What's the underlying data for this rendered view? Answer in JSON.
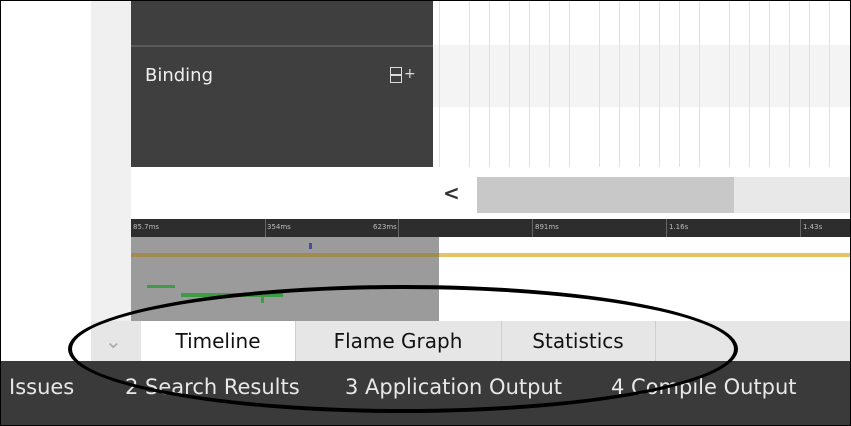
{
  "category": {
    "label": "Binding",
    "expand_icon": "expand-rows-icon"
  },
  "scrollbar": {
    "left_arrow": "<",
    "thumb_fraction": 0.69
  },
  "ruler": {
    "ticks": [
      "85.7ms",
      "354ms",
      "623ms",
      "891ms",
      "1.16s",
      "1.43s"
    ]
  },
  "tabs": [
    {
      "label": "Timeline",
      "active": true
    },
    {
      "label": "Flame Graph",
      "active": false
    },
    {
      "label": "Statistics",
      "active": false
    }
  ],
  "collapse_icon": "chevron-down-icon",
  "output_panes": [
    {
      "label": "Issues"
    },
    {
      "label": "2  Search Results"
    },
    {
      "label": "3  Application Output"
    },
    {
      "label": "4  Compile Output"
    }
  ],
  "colors": {
    "panel_dark": "#3f3f3f",
    "output_bar": "#3a3a3a",
    "event_yellow": "#e2c466",
    "event_green": "#3f9b48",
    "annotation": "#000000"
  }
}
